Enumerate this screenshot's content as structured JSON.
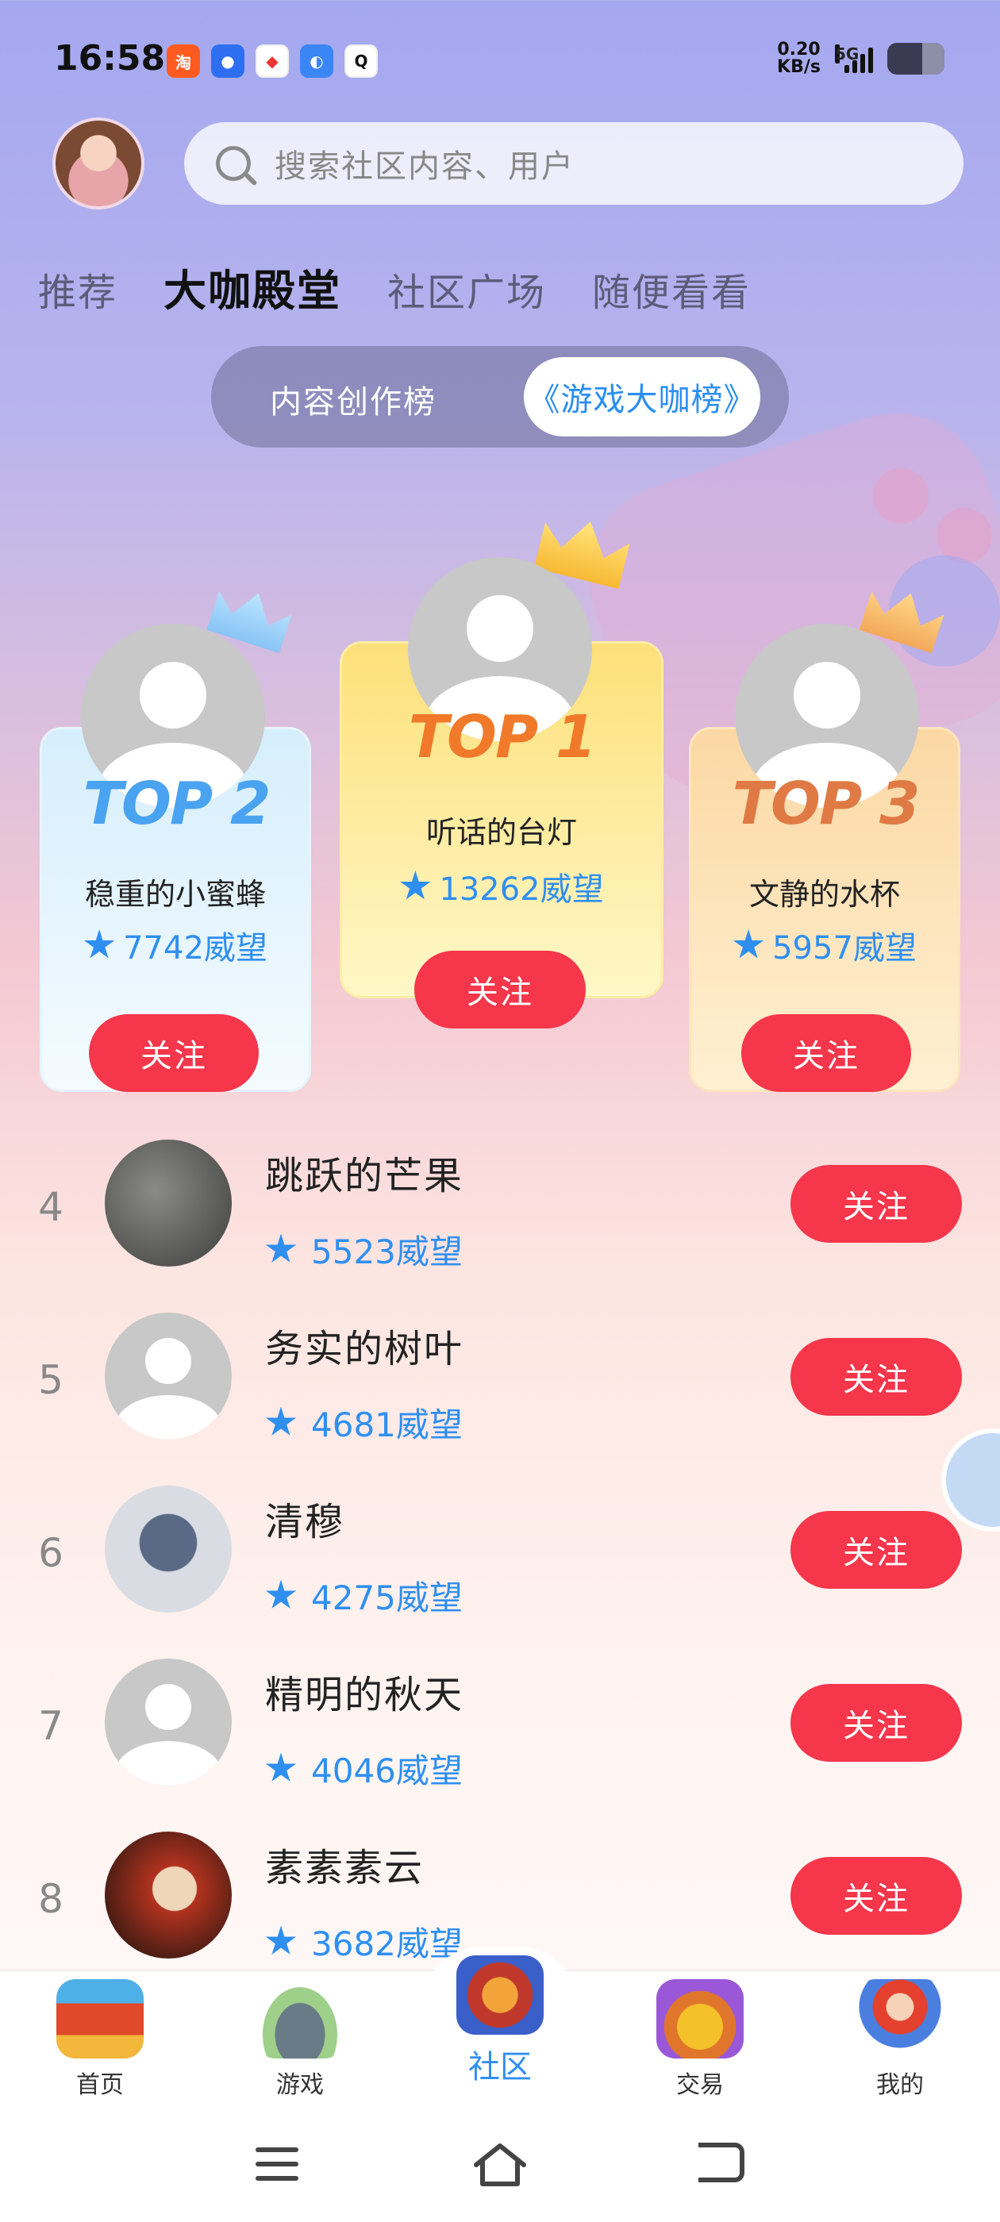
{
  "status_bar": {
    "time": "16:58",
    "net_speed_value": "0.20",
    "net_speed_unit": "KB/s",
    "network": "5G",
    "app_icons": [
      "taobao-icon",
      "baidu-icon",
      "map-icon",
      "browser-icon",
      "qq-icon"
    ]
  },
  "search": {
    "placeholder": "搜索社区内容、用户"
  },
  "tabs": [
    "推荐",
    "大咖殿堂",
    "社区广场",
    "随便看看"
  ],
  "active_tab": "大咖殿堂",
  "segment": {
    "left": "内容创作榜",
    "right": "《游戏大咖榜》",
    "active": "right"
  },
  "podium": [
    {
      "rank_label": "TOP 2",
      "name": "稳重的小蜜蜂",
      "score": "7742威望",
      "follow": "关注"
    },
    {
      "rank_label": "TOP 1",
      "name": "听话的台灯",
      "score": "13262威望",
      "follow": "关注"
    },
    {
      "rank_label": "TOP 3",
      "name": "文静的水杯",
      "score": "5957威望",
      "follow": "关注"
    }
  ],
  "list": [
    {
      "rank": "4",
      "name": "跳跃的芒果",
      "score": "5523威望",
      "follow": "关注"
    },
    {
      "rank": "5",
      "name": "务实的树叶",
      "score": "4681威望",
      "follow": "关注"
    },
    {
      "rank": "6",
      "name": "清穆",
      "score": "4275威望",
      "follow": "关注"
    },
    {
      "rank": "7",
      "name": "精明的秋天",
      "score": "4046威望",
      "follow": "关注"
    },
    {
      "rank": "8",
      "name": "素素素云",
      "score": "3682威望",
      "follow": "关注"
    }
  ],
  "bottom_nav": [
    {
      "label": "首页",
      "icon": "home-gate-icon"
    },
    {
      "label": "游戏",
      "icon": "floating-island-icon"
    },
    {
      "label": "社区",
      "icon": "community-chest-icon",
      "active": true
    },
    {
      "label": "交易",
      "icon": "treasure-bag-icon"
    },
    {
      "label": "我的",
      "icon": "character-icon"
    }
  ],
  "colors": {
    "accent_blue": "#2f8ff0",
    "follow_red": "#f5364b"
  }
}
